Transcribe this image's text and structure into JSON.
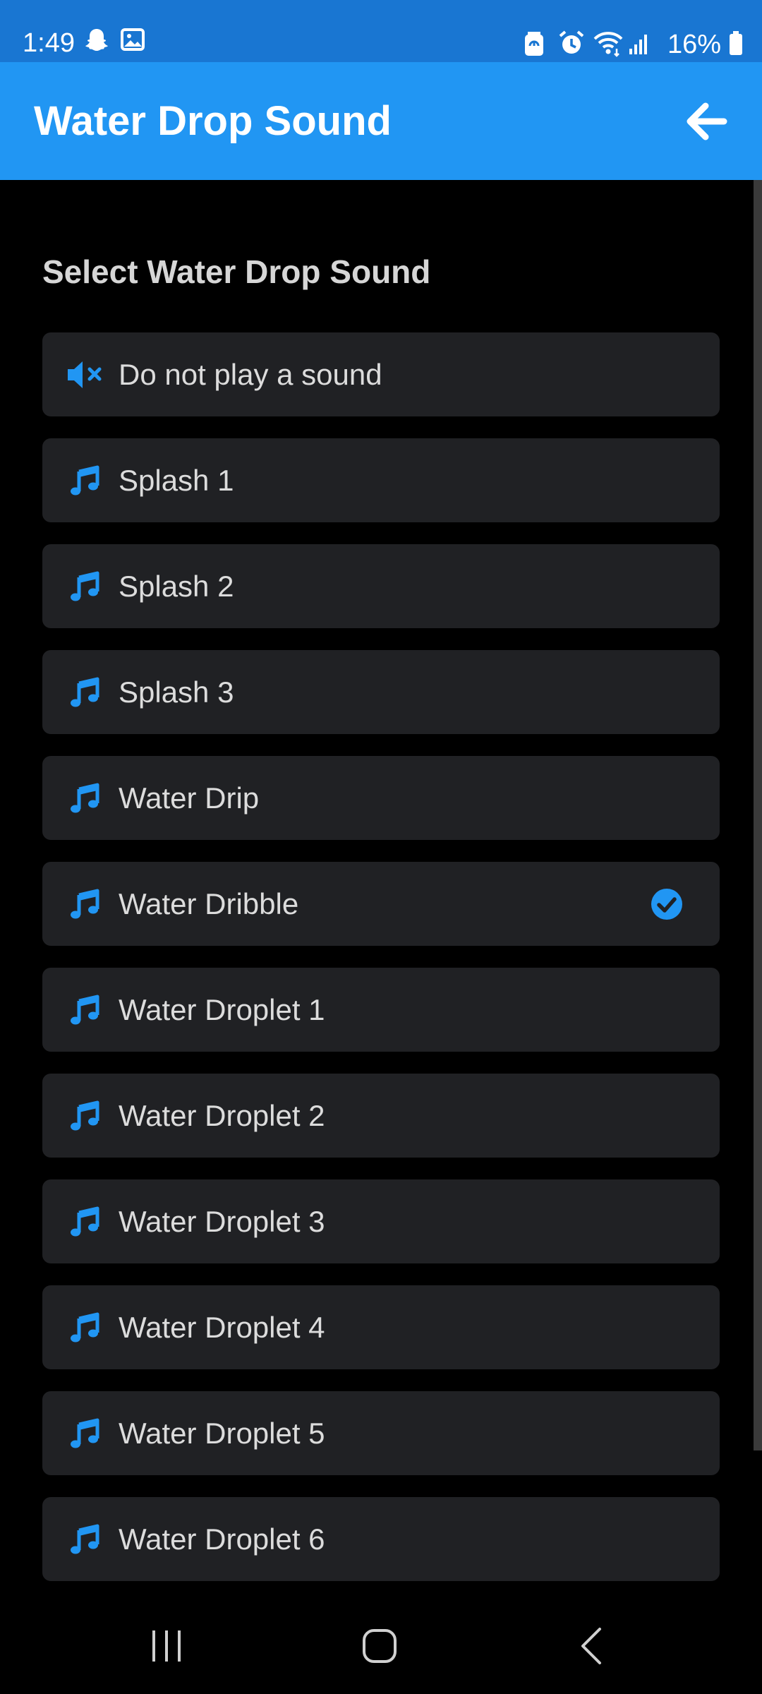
{
  "status_bar": {
    "time": "1:49",
    "battery_percent": "16%",
    "left_icons": [
      "snapchat-icon",
      "gallery-icon"
    ],
    "right_icons": [
      "battery-saver-icon",
      "alarm-icon",
      "wifi-icon",
      "signal-icon",
      "battery-icon"
    ]
  },
  "app_bar": {
    "title": "Water Drop Sound",
    "back_icon": "arrow-back-icon"
  },
  "content": {
    "section_title": "Select Water Drop Sound",
    "items": [
      {
        "label": "Do not play a sound",
        "icon": "mute-icon",
        "selected": false
      },
      {
        "label": "Splash 1",
        "icon": "music-note-icon",
        "selected": false
      },
      {
        "label": "Splash 2",
        "icon": "music-note-icon",
        "selected": false
      },
      {
        "label": "Splash 3",
        "icon": "music-note-icon",
        "selected": false
      },
      {
        "label": "Water Drip",
        "icon": "music-note-icon",
        "selected": false
      },
      {
        "label": "Water Dribble",
        "icon": "music-note-icon",
        "selected": true
      },
      {
        "label": "Water Droplet 1",
        "icon": "music-note-icon",
        "selected": false
      },
      {
        "label": "Water Droplet 2",
        "icon": "music-note-icon",
        "selected": false
      },
      {
        "label": "Water Droplet 3",
        "icon": "music-note-icon",
        "selected": false
      },
      {
        "label": "Water Droplet 4",
        "icon": "music-note-icon",
        "selected": false
      },
      {
        "label": "Water Droplet 5",
        "icon": "music-note-icon",
        "selected": false
      },
      {
        "label": "Water Droplet 6",
        "icon": "music-note-icon",
        "selected": false
      }
    ]
  },
  "nav_bar": {
    "buttons": [
      "recents-icon",
      "home-icon",
      "back-icon"
    ]
  },
  "colors": {
    "status_bar": "#1976d2",
    "app_bar": "#2196f3",
    "accent": "#2196f3",
    "background": "#000000",
    "item_background": "#202124",
    "item_text": "#dcdcdc"
  }
}
